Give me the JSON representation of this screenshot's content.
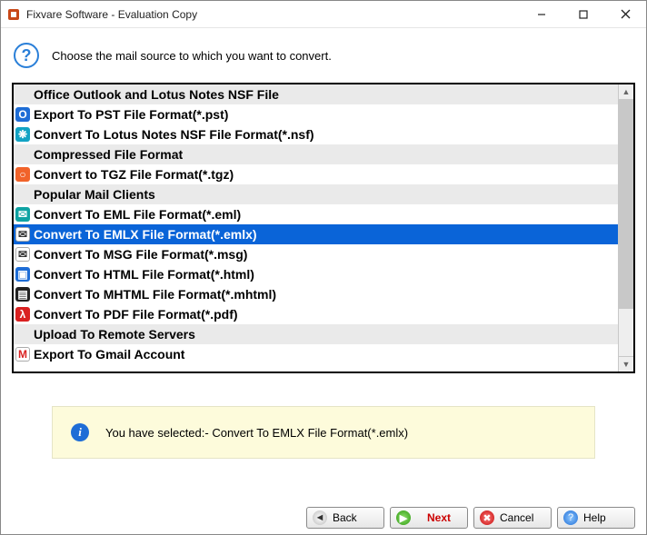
{
  "window": {
    "title": "Fixvare Software - Evaluation Copy"
  },
  "instruction": "Choose the mail source to which you want to convert.",
  "list": {
    "rows": [
      {
        "kind": "header",
        "label": "Office Outlook and Lotus Notes NSF File"
      },
      {
        "kind": "item",
        "icon": "pst-icon",
        "iconClass": "ic-blue",
        "glyph": "O",
        "label": "Export To PST File Format(*.pst)"
      },
      {
        "kind": "item",
        "icon": "nsf-icon",
        "iconClass": "ic-teal",
        "glyph": "❋",
        "label": "Convert To Lotus Notes NSF File Format(*.nsf)"
      },
      {
        "kind": "header",
        "label": "Compressed File Format"
      },
      {
        "kind": "item",
        "icon": "tgz-icon",
        "iconClass": "ic-orange",
        "glyph": "○",
        "label": "Convert to TGZ File Format(*.tgz)"
      },
      {
        "kind": "header",
        "label": "Popular Mail Clients"
      },
      {
        "kind": "item",
        "icon": "eml-icon",
        "iconClass": "ic-gteal",
        "glyph": "✉",
        "label": "Convert To EML File Format(*.eml)"
      },
      {
        "kind": "item",
        "icon": "emlx-icon",
        "iconClass": "ic-white",
        "glyph": "✉",
        "label": "Convert To EMLX File Format(*.emlx)",
        "selected": true
      },
      {
        "kind": "item",
        "icon": "msg-icon",
        "iconClass": "ic-white",
        "glyph": "✉",
        "label": "Convert To MSG File Format(*.msg)"
      },
      {
        "kind": "item",
        "icon": "html-icon",
        "iconClass": "ic-blue",
        "glyph": "▣",
        "label": "Convert To HTML File Format(*.html)"
      },
      {
        "kind": "item",
        "icon": "mhtml-icon",
        "iconClass": "ic-dark",
        "glyph": "▤",
        "label": "Convert To MHTML File Format(*.mhtml)"
      },
      {
        "kind": "item",
        "icon": "pdf-icon",
        "iconClass": "ic-red",
        "glyph": "λ",
        "label": "Convert To PDF File Format(*.pdf)"
      },
      {
        "kind": "header",
        "label": "Upload To Remote Servers"
      },
      {
        "kind": "item",
        "icon": "gmail-icon",
        "iconClass": "ic-mail",
        "glyph": "M",
        "label": "Export To Gmail Account"
      }
    ]
  },
  "status": {
    "text": "You have selected:- Convert To EMLX File Format(*.emlx)"
  },
  "footer": {
    "back": "Back",
    "next": "Next",
    "cancel": "Cancel",
    "help": "Help"
  }
}
